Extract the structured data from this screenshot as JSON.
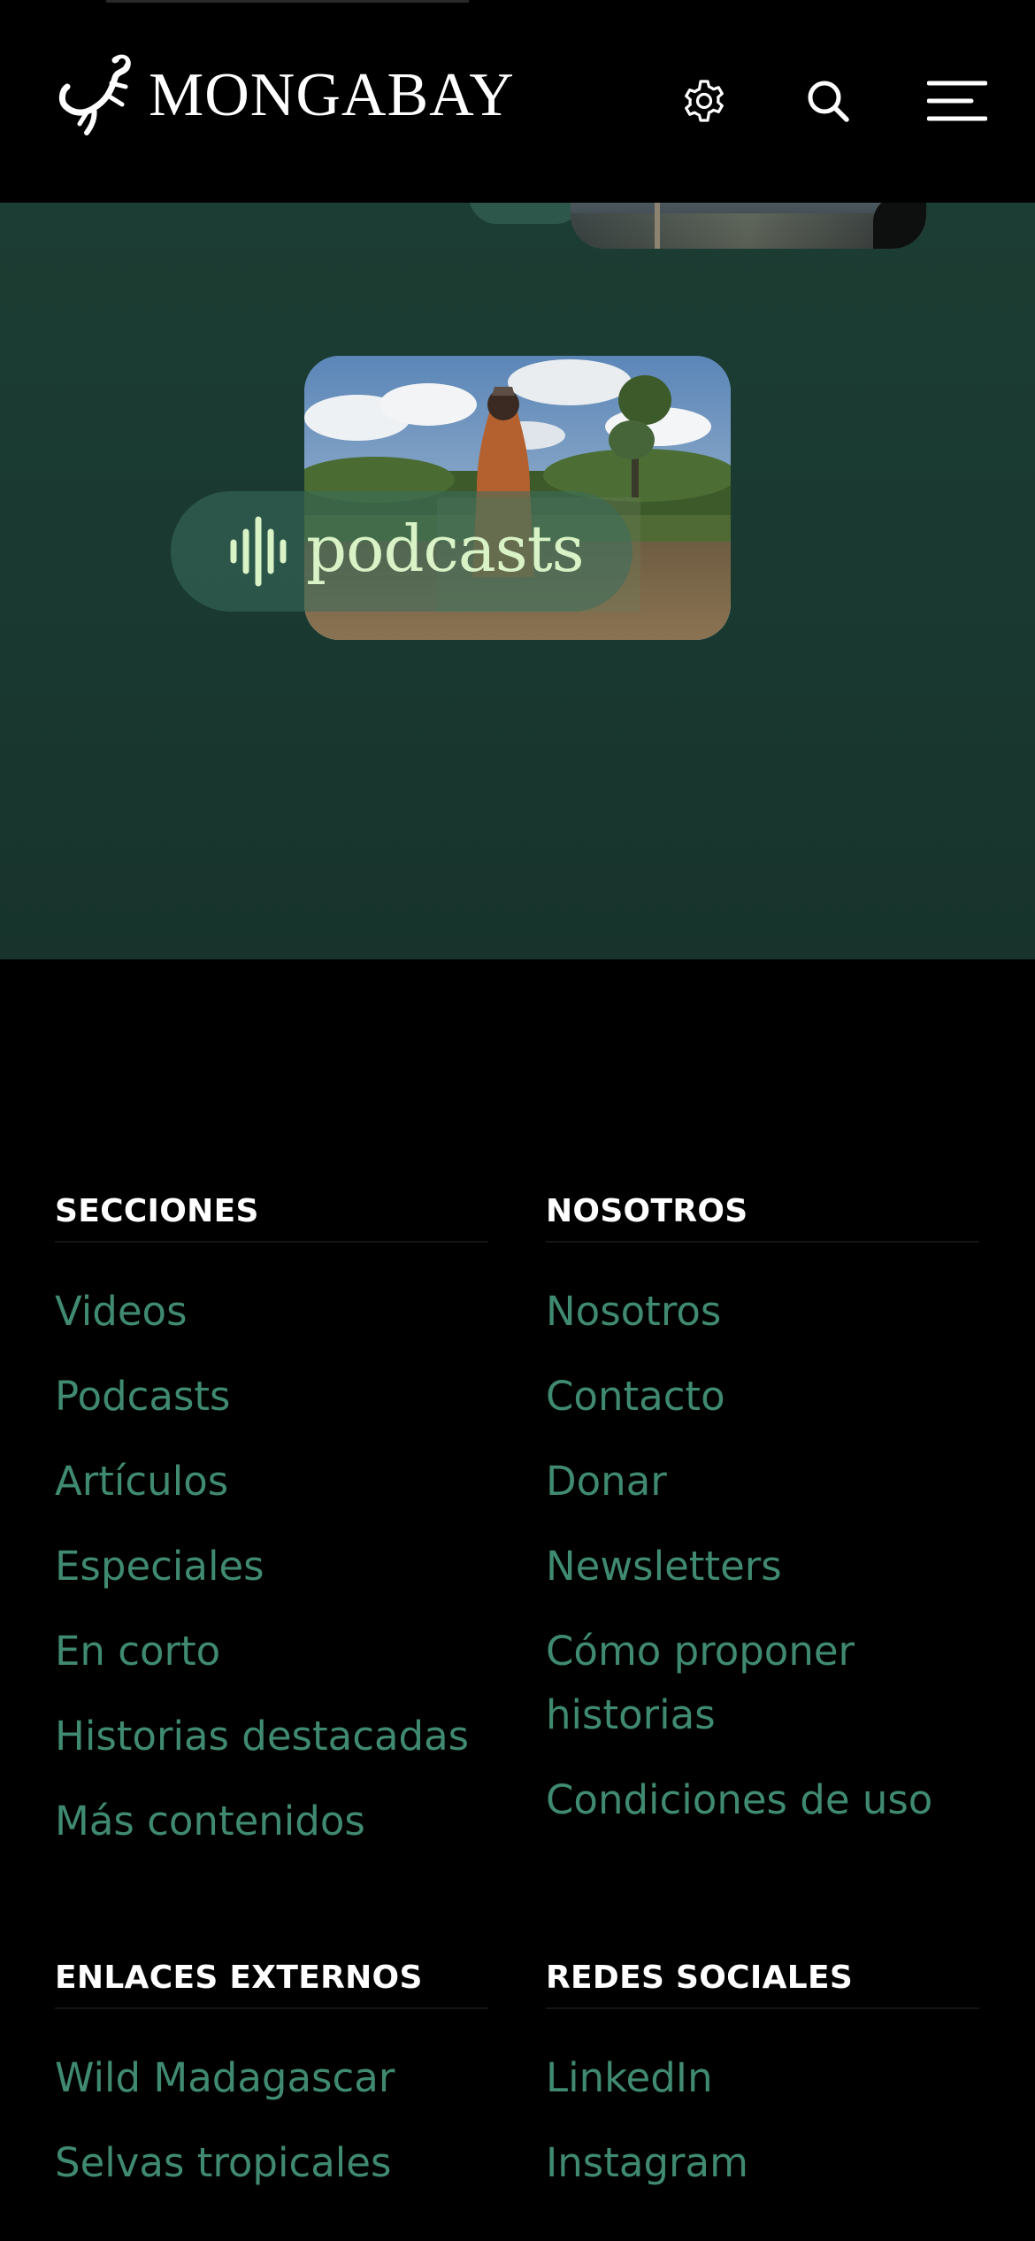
{
  "header": {
    "logo_text": "MONGABAY",
    "icons": {
      "settings": "gear-icon",
      "search": "search-icon",
      "menu": "hamburger-menu-icon"
    }
  },
  "hero": {
    "podcast_label": "podcasts",
    "podcast_icon": "sound-wave-icon",
    "colors": {
      "background": "#1c3d33",
      "pill_text": "#d9f2c6"
    }
  },
  "footer": {
    "colors": {
      "heading": "#ffffff",
      "link": "#3f8a70"
    },
    "secciones": {
      "heading": "SECCIONES",
      "links": [
        "Videos",
        "Podcasts",
        "Artículos",
        "Especiales",
        "En corto",
        "Historias destacadas",
        "Más contenidos"
      ]
    },
    "nosotros": {
      "heading": "NOSOTROS",
      "links": [
        "Nosotros",
        "Contacto",
        "Donar",
        "Newsletters",
        "Cómo proponer historias",
        "Condiciones de uso"
      ]
    },
    "enlaces": {
      "heading": "ENLACES EXTERNOS",
      "links": [
        "Wild Madagascar",
        "Selvas tropicales"
      ]
    },
    "redes": {
      "heading": "REDES SOCIALES",
      "links": [
        "LinkedIn",
        "Instagram"
      ]
    }
  }
}
